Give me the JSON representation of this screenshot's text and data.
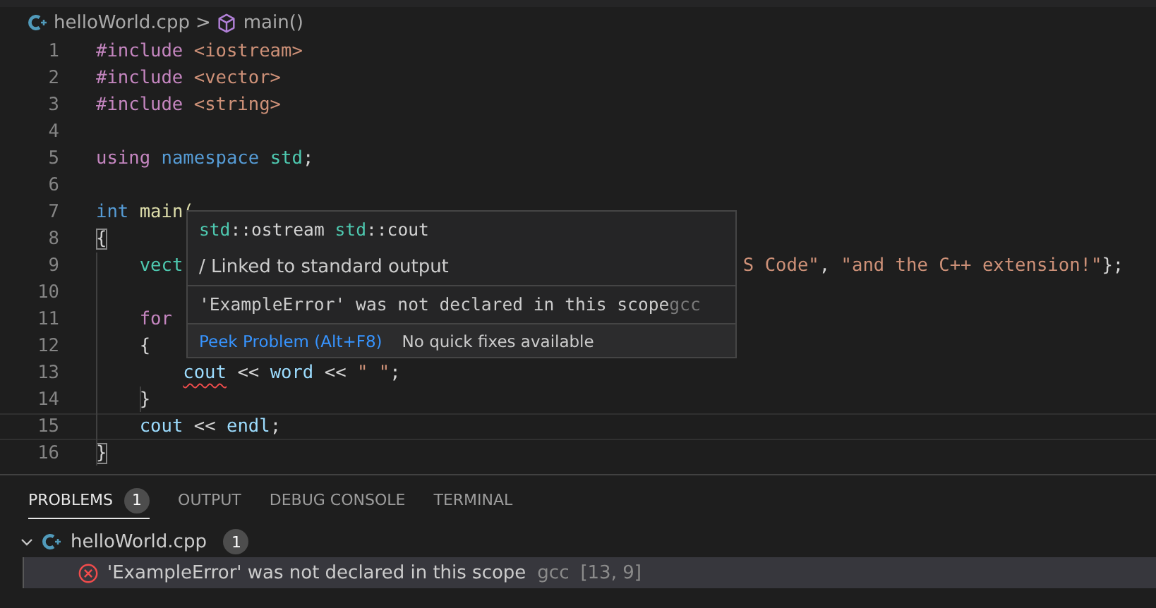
{
  "breadcrumb": {
    "file": "helloWorld.cpp",
    "separator": ">",
    "symbol": "main()"
  },
  "editor": {
    "lines": [
      {
        "number": "1",
        "current": false,
        "tokens": [
          {
            "kind": "keyword",
            "text": "#include"
          },
          {
            "kind": "string",
            "text": " <iostream>"
          }
        ]
      },
      {
        "number": "2",
        "current": false,
        "tokens": [
          {
            "kind": "keyword",
            "text": "#include"
          },
          {
            "kind": "string",
            "text": " <vector>"
          }
        ]
      },
      {
        "number": "3",
        "current": false,
        "tokens": [
          {
            "kind": "keyword",
            "text": "#include"
          },
          {
            "kind": "string",
            "text": " <string>"
          }
        ]
      },
      {
        "number": "4",
        "current": false
      },
      {
        "number": "5",
        "current": false,
        "tokens": [
          {
            "kind": "keyword",
            "text": "using"
          },
          {
            "kind": "storage",
            "text": " namespace"
          },
          {
            "kind": "type",
            "text": " std"
          },
          {
            "kind": "plain",
            "text": ";"
          }
        ]
      },
      {
        "number": "6",
        "current": false
      },
      {
        "number": "7",
        "current": false,
        "tokens": [
          {
            "kind": "storage",
            "text": "int"
          },
          {
            "kind": "function",
            "text": " main("
          }
        ]
      },
      {
        "number": "8",
        "current": false,
        "tokens": [
          {
            "kind": "plain",
            "text": "{",
            "matched": true
          }
        ]
      },
      {
        "number": "9",
        "current": false,
        "tokens": [
          {
            "kind": "type",
            "text": "    vect"
          },
          {
            "kind": "string",
            "text": "S Code\"",
            "resume": true
          },
          {
            "kind": "plain",
            "text": ", "
          },
          {
            "kind": "string",
            "text": "\"and the C++ extension!\""
          },
          {
            "kind": "plain",
            "text": "};"
          }
        ]
      },
      {
        "number": "10",
        "current": false
      },
      {
        "number": "11",
        "current": false,
        "tokens": [
          {
            "kind": "keyword",
            "text": "    for"
          }
        ]
      },
      {
        "number": "12",
        "current": false,
        "tokens": [
          {
            "kind": "plain",
            "text": "    {"
          }
        ]
      },
      {
        "number": "13",
        "current": false,
        "tokens": [
          {
            "kind": "variable",
            "text": "        cout",
            "error": true
          },
          {
            "kind": "plain",
            "text": " << "
          },
          {
            "kind": "variable",
            "text": "word"
          },
          {
            "kind": "plain",
            "text": " << "
          },
          {
            "kind": "string",
            "text": "\" \""
          },
          {
            "kind": "plain",
            "text": ";"
          }
        ]
      },
      {
        "number": "14",
        "current": false,
        "tokens": [
          {
            "kind": "plain",
            "text": "    }"
          }
        ]
      },
      {
        "number": "15",
        "current": true,
        "tokens": [
          {
            "kind": "variable",
            "text": "    cout"
          },
          {
            "kind": "plain",
            "text": " << "
          },
          {
            "kind": "variable",
            "text": "endl"
          },
          {
            "kind": "plain",
            "text": ";"
          }
        ]
      },
      {
        "number": "16",
        "current": false,
        "tokens": [
          {
            "kind": "plain",
            "text": "}",
            "matched": true
          }
        ]
      }
    ]
  },
  "hover": {
    "signature": [
      {
        "kind": "type",
        "text": "std"
      },
      {
        "kind": "plain",
        "text": "::ostream "
      },
      {
        "kind": "type",
        "text": "std"
      },
      {
        "kind": "plain",
        "text": "::cout"
      }
    ],
    "doc": "/ Linked to standard output",
    "error": "'ExampleError' was not declared in this scope",
    "source": "gcc",
    "peek": "Peek Problem (Alt+F8)",
    "quick_fix": "No quick fixes available"
  },
  "panel": {
    "tabs": [
      {
        "label": "PROBLEMS",
        "badge": "1",
        "selected": true
      },
      {
        "label": "OUTPUT",
        "selected": false
      },
      {
        "label": "DEBUG CONSOLE",
        "selected": false
      },
      {
        "label": "TERMINAL",
        "selected": false
      }
    ],
    "file": {
      "name": "helloWorld.cpp",
      "count": "1",
      "expanded": true
    },
    "problems": [
      {
        "message": "'ExampleError' was not declared in this scope",
        "source": "gcc",
        "location": "[13, 9]",
        "selected": true
      }
    ]
  }
}
